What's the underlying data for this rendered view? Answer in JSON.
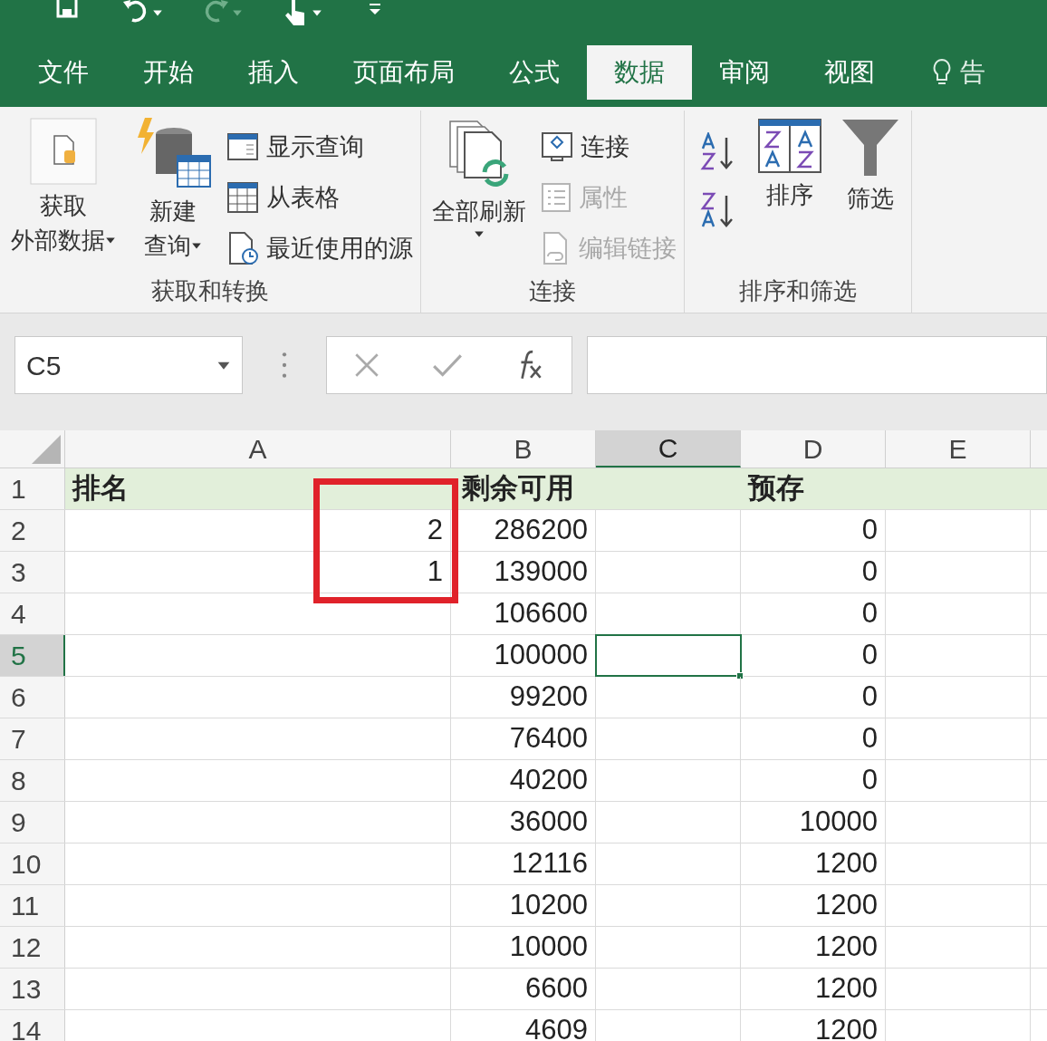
{
  "quick_access": [
    {
      "kind": "save",
      "disabled": false
    },
    {
      "kind": "undo",
      "disabled": false
    },
    {
      "kind": "redo",
      "disabled": true
    },
    {
      "kind": "touch",
      "disabled": false
    },
    {
      "kind": "customize",
      "disabled": false
    }
  ],
  "tabs": [
    {
      "label": "文件",
      "selected": false
    },
    {
      "label": "开始",
      "selected": false
    },
    {
      "label": "插入",
      "selected": false
    },
    {
      "label": "页面布局",
      "selected": false
    },
    {
      "label": "公式",
      "selected": false
    },
    {
      "label": "数据",
      "selected": true
    },
    {
      "label": "审阅",
      "selected": false
    },
    {
      "label": "视图",
      "selected": false
    },
    {
      "label": "告",
      "selected": false,
      "kind": "tell"
    }
  ],
  "ribbon_groups": [
    {
      "label": "获取和转换",
      "items": [
        {
          "kind": "get-data",
          "lines": [
            "获取",
            "外部数据"
          ],
          "disabled": false
        },
        {
          "kind": "new-query",
          "lines": [
            "新建",
            "查询"
          ],
          "disabled": false
        },
        {
          "kind": "show-query",
          "label": "显示查询",
          "disabled": false
        },
        {
          "kind": "from-table",
          "label": "从表格",
          "disabled": false
        },
        {
          "kind": "recent",
          "label": "最近使用的源",
          "disabled": false
        }
      ]
    },
    {
      "label": "连接",
      "items": [
        {
          "kind": "refresh",
          "lines": [
            "全部刷新"
          ],
          "disabled": false
        },
        {
          "kind": "connections",
          "label": "连接",
          "disabled": false
        },
        {
          "kind": "properties",
          "label": "属性",
          "disabled": true
        },
        {
          "kind": "edit-links",
          "label": "编辑链接",
          "disabled": true
        }
      ]
    },
    {
      "label": "排序和筛选",
      "items": [
        {
          "kind": "sort-asc",
          "disabled": false
        },
        {
          "kind": "sort-desc",
          "disabled": false
        },
        {
          "kind": "sort",
          "lines": [
            "排序"
          ],
          "disabled": false
        },
        {
          "kind": "filter",
          "lines": [
            "筛选"
          ],
          "disabled": false
        }
      ]
    }
  ],
  "name_box": "C5",
  "columns": [
    {
      "label": "A",
      "selected": false
    },
    {
      "label": "B",
      "selected": false
    },
    {
      "label": "C",
      "selected": true
    },
    {
      "label": "D",
      "selected": false
    },
    {
      "label": "E",
      "selected": false
    }
  ],
  "rows": [
    {
      "header": "1",
      "kind": "header",
      "selected": false,
      "cells": {
        "a": "排名",
        "b": "剩余可用",
        "d": "预存"
      }
    },
    {
      "header": "2",
      "kind": "data",
      "selected": false,
      "cells": {
        "a": "2",
        "b": "286200",
        "d": "0"
      }
    },
    {
      "header": "3",
      "kind": "data",
      "selected": false,
      "cells": {
        "a": "1",
        "b": "139000",
        "d": "0"
      }
    },
    {
      "header": "4",
      "kind": "data",
      "selected": false,
      "cells": {
        "b": "106600",
        "d": "0"
      }
    },
    {
      "header": "5",
      "kind": "data",
      "selected": true,
      "cells": {
        "b": "100000",
        "d": "0"
      }
    },
    {
      "header": "6",
      "kind": "data",
      "selected": false,
      "cells": {
        "b": "99200",
        "d": "0"
      }
    },
    {
      "header": "7",
      "kind": "data",
      "selected": false,
      "cells": {
        "b": "76400",
        "d": "0"
      }
    },
    {
      "header": "8",
      "kind": "data",
      "selected": false,
      "cells": {
        "b": "40200",
        "d": "0"
      }
    },
    {
      "header": "9",
      "kind": "data",
      "selected": false,
      "cells": {
        "b": "36000",
        "d": "10000"
      }
    },
    {
      "header": "10",
      "kind": "data",
      "selected": false,
      "cells": {
        "b": "12116",
        "d": "1200"
      }
    },
    {
      "header": "11",
      "kind": "data",
      "selected": false,
      "cells": {
        "b": "10200",
        "d": "1200"
      }
    },
    {
      "header": "12",
      "kind": "data",
      "selected": false,
      "cells": {
        "b": "10000",
        "d": "1200"
      }
    },
    {
      "header": "13",
      "kind": "data",
      "selected": false,
      "cells": {
        "b": "6600",
        "d": "1200"
      }
    },
    {
      "header": "14",
      "kind": "data",
      "selected": false,
      "cells": {
        "b": "4609",
        "d": "1200"
      }
    }
  ]
}
